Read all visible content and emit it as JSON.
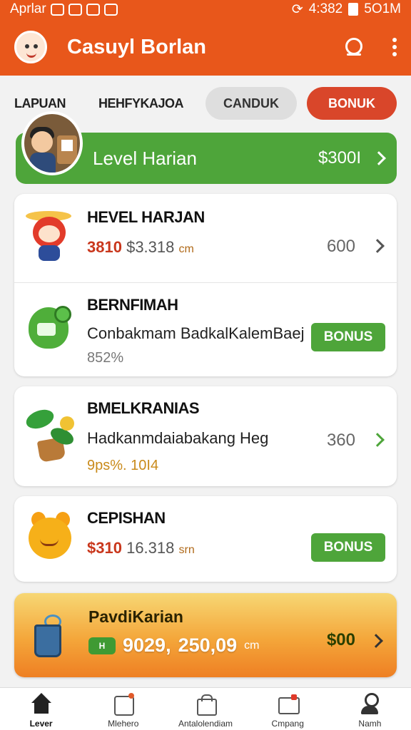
{
  "status_bar": {
    "app_name": "Aprlar",
    "time": "4:382",
    "right_text": "5O1M"
  },
  "app_bar": {
    "title": "Casuyl Borlan",
    "icons": [
      "search-icon",
      "more-vert-icon"
    ]
  },
  "tabs": [
    {
      "label": "LAPUAN"
    },
    {
      "label": "HEHFYKAJOA"
    },
    {
      "label": "CANDUK"
    },
    {
      "label": "BONUK"
    }
  ],
  "level_banner": {
    "label": "Level Harian",
    "value": "$300I"
  },
  "cards": {
    "hevel": {
      "title": "HEVEL HARJAN",
      "price": "3810",
      "price2": "$3.318",
      "unit": "cm",
      "value": "600"
    },
    "bernfimah": {
      "title": "BERNFIMAH",
      "subtitle": "Conbakmam BadkalKalemBaej",
      "meta": "852%",
      "button": "BONUS"
    },
    "bmelkranias": {
      "title": "BMELKRANIAS",
      "subtitle": "Hadkanmdaiabakang Heg",
      "meta": "9ps%. 10I4",
      "value": "360"
    },
    "cepishan": {
      "title": "CEPISHAN",
      "price": "$310",
      "price2": "16.318",
      "unit": "srn",
      "button": "BONUS"
    }
  },
  "gold_card": {
    "title": "PavdiKarian",
    "ticket": "H",
    "amount": "9029,",
    "amount_mid": "250,09",
    "unit": "cm",
    "value": "$00"
  },
  "bottom_nav": [
    {
      "label": "Lever",
      "icon": "home-icon"
    },
    {
      "label": "Mlehero",
      "icon": "box-icon"
    },
    {
      "label": "Antalolendiam",
      "icon": "bag-icon"
    },
    {
      "label": "Cmpang",
      "icon": "mail-icon"
    },
    {
      "label": "Namh",
      "icon": "user-icon"
    }
  ],
  "colors": {
    "primary": "#e8571b",
    "green": "#4ea53a",
    "red": "#d9462a"
  }
}
